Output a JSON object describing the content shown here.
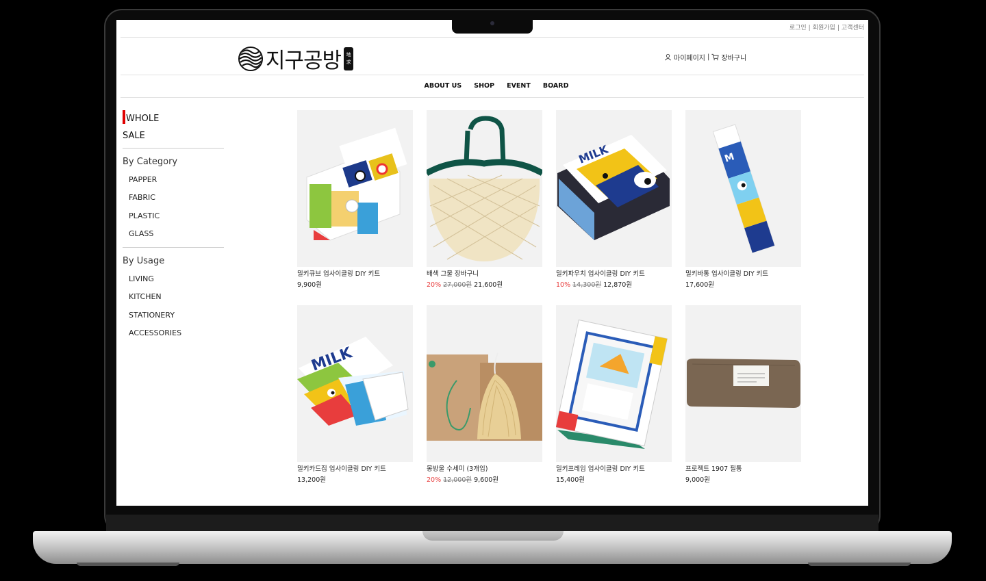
{
  "top_links": [
    "로그인",
    "회원가입",
    "고객센터"
  ],
  "logo": {
    "text": "지구공방",
    "seal_top": "地",
    "seal_bottom": "求"
  },
  "user_nav": {
    "mypage": "마이페이지",
    "separator": "|",
    "cart": "장바구니"
  },
  "main_nav": [
    "ABOUT US",
    "SHOP",
    "EVENT",
    "BOARD"
  ],
  "sidebar": {
    "whole": "WHOLE",
    "sale": "SALE",
    "by_category": {
      "title": "By Category",
      "items": [
        "PAPPER",
        "FABRIC",
        "PLASTIC",
        "GLASS"
      ]
    },
    "by_usage": {
      "title": "By Usage",
      "items": [
        "LIVING",
        "KITCHEN",
        "STATIONERY",
        "ACCESSORIES"
      ]
    }
  },
  "products": [
    {
      "name": "밀키큐브 업사이클링 DIY 키트",
      "discount": "",
      "original": "",
      "price": "9,900원"
    },
    {
      "name": "배색 그물 장바구니",
      "discount": "20%",
      "original": "27,000원",
      "price": "21,600원"
    },
    {
      "name": "밀키파우치 업사이클링 DIY 키트",
      "discount": "10%",
      "original": "14,300원",
      "price": "12,870원"
    },
    {
      "name": "밀키바통 업사이클링 DIY 키트",
      "discount": "",
      "original": "",
      "price": "17,600원"
    },
    {
      "name": "밀키카드집 업사이클링 DIY 키트",
      "discount": "",
      "original": "",
      "price": "13,200원"
    },
    {
      "name": "몽방울 수세미 (3개입)",
      "discount": "20%",
      "original": "12,000원",
      "price": "9,600원"
    },
    {
      "name": "밀키프레임 업사이클링 DIY 키트",
      "discount": "",
      "original": "",
      "price": "15,400원"
    },
    {
      "name": "프로젝트 1907 필통",
      "discount": "",
      "original": "",
      "price": "9,000원"
    }
  ],
  "colors": {
    "accent_red": "#e00000",
    "discount_red": "#e94040",
    "net_green": "#0f5446"
  }
}
